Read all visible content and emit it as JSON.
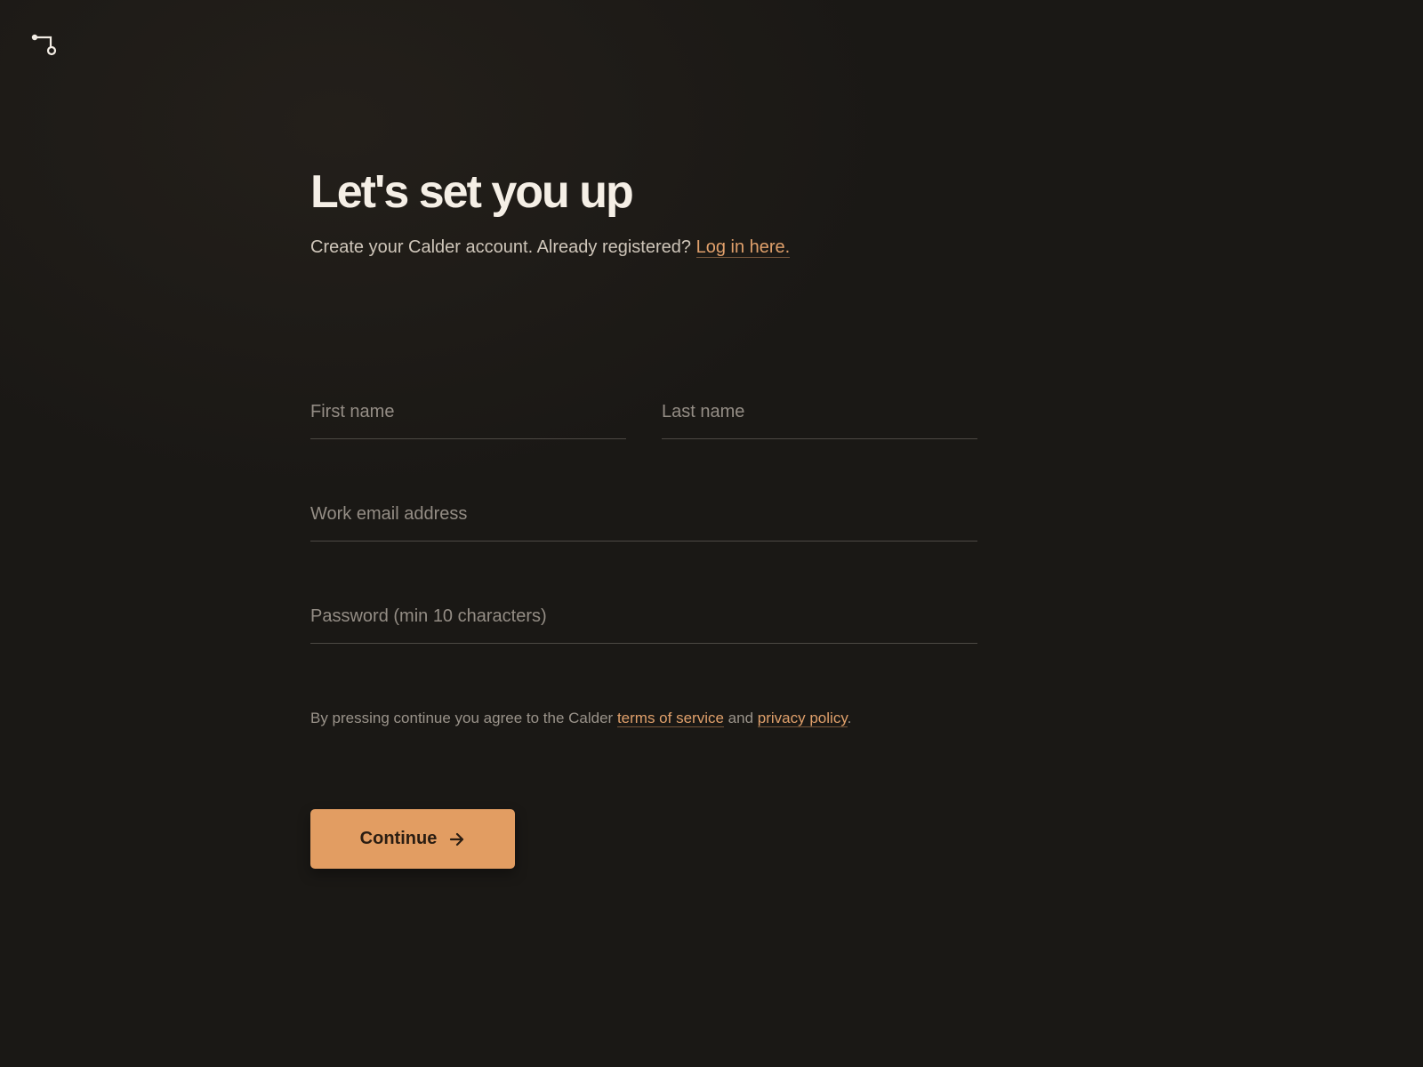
{
  "header": {
    "logo_icon": "branch-route-icon"
  },
  "page": {
    "title": "Let's set you up",
    "subtitle_text": "Create your Calder account. Already registered?",
    "login_link": "Log in here."
  },
  "form": {
    "first_name_placeholder": "First name",
    "last_name_placeholder": "Last name",
    "email_placeholder": "Work email address",
    "password_placeholder": "Password (min 10 characters)"
  },
  "terms": {
    "prefix": "By pressing continue you agree to the Calder",
    "terms_link": "terms of service",
    "middle": "and",
    "privacy_link": "privacy policy",
    "suffix": "."
  },
  "actions": {
    "continue_label": "Continue",
    "continue_icon": "arrow-right-icon"
  },
  "colors": {
    "background": "#1a1815",
    "accent": "#e29d62",
    "link": "#e0a06b",
    "text": "#f5efe6"
  }
}
